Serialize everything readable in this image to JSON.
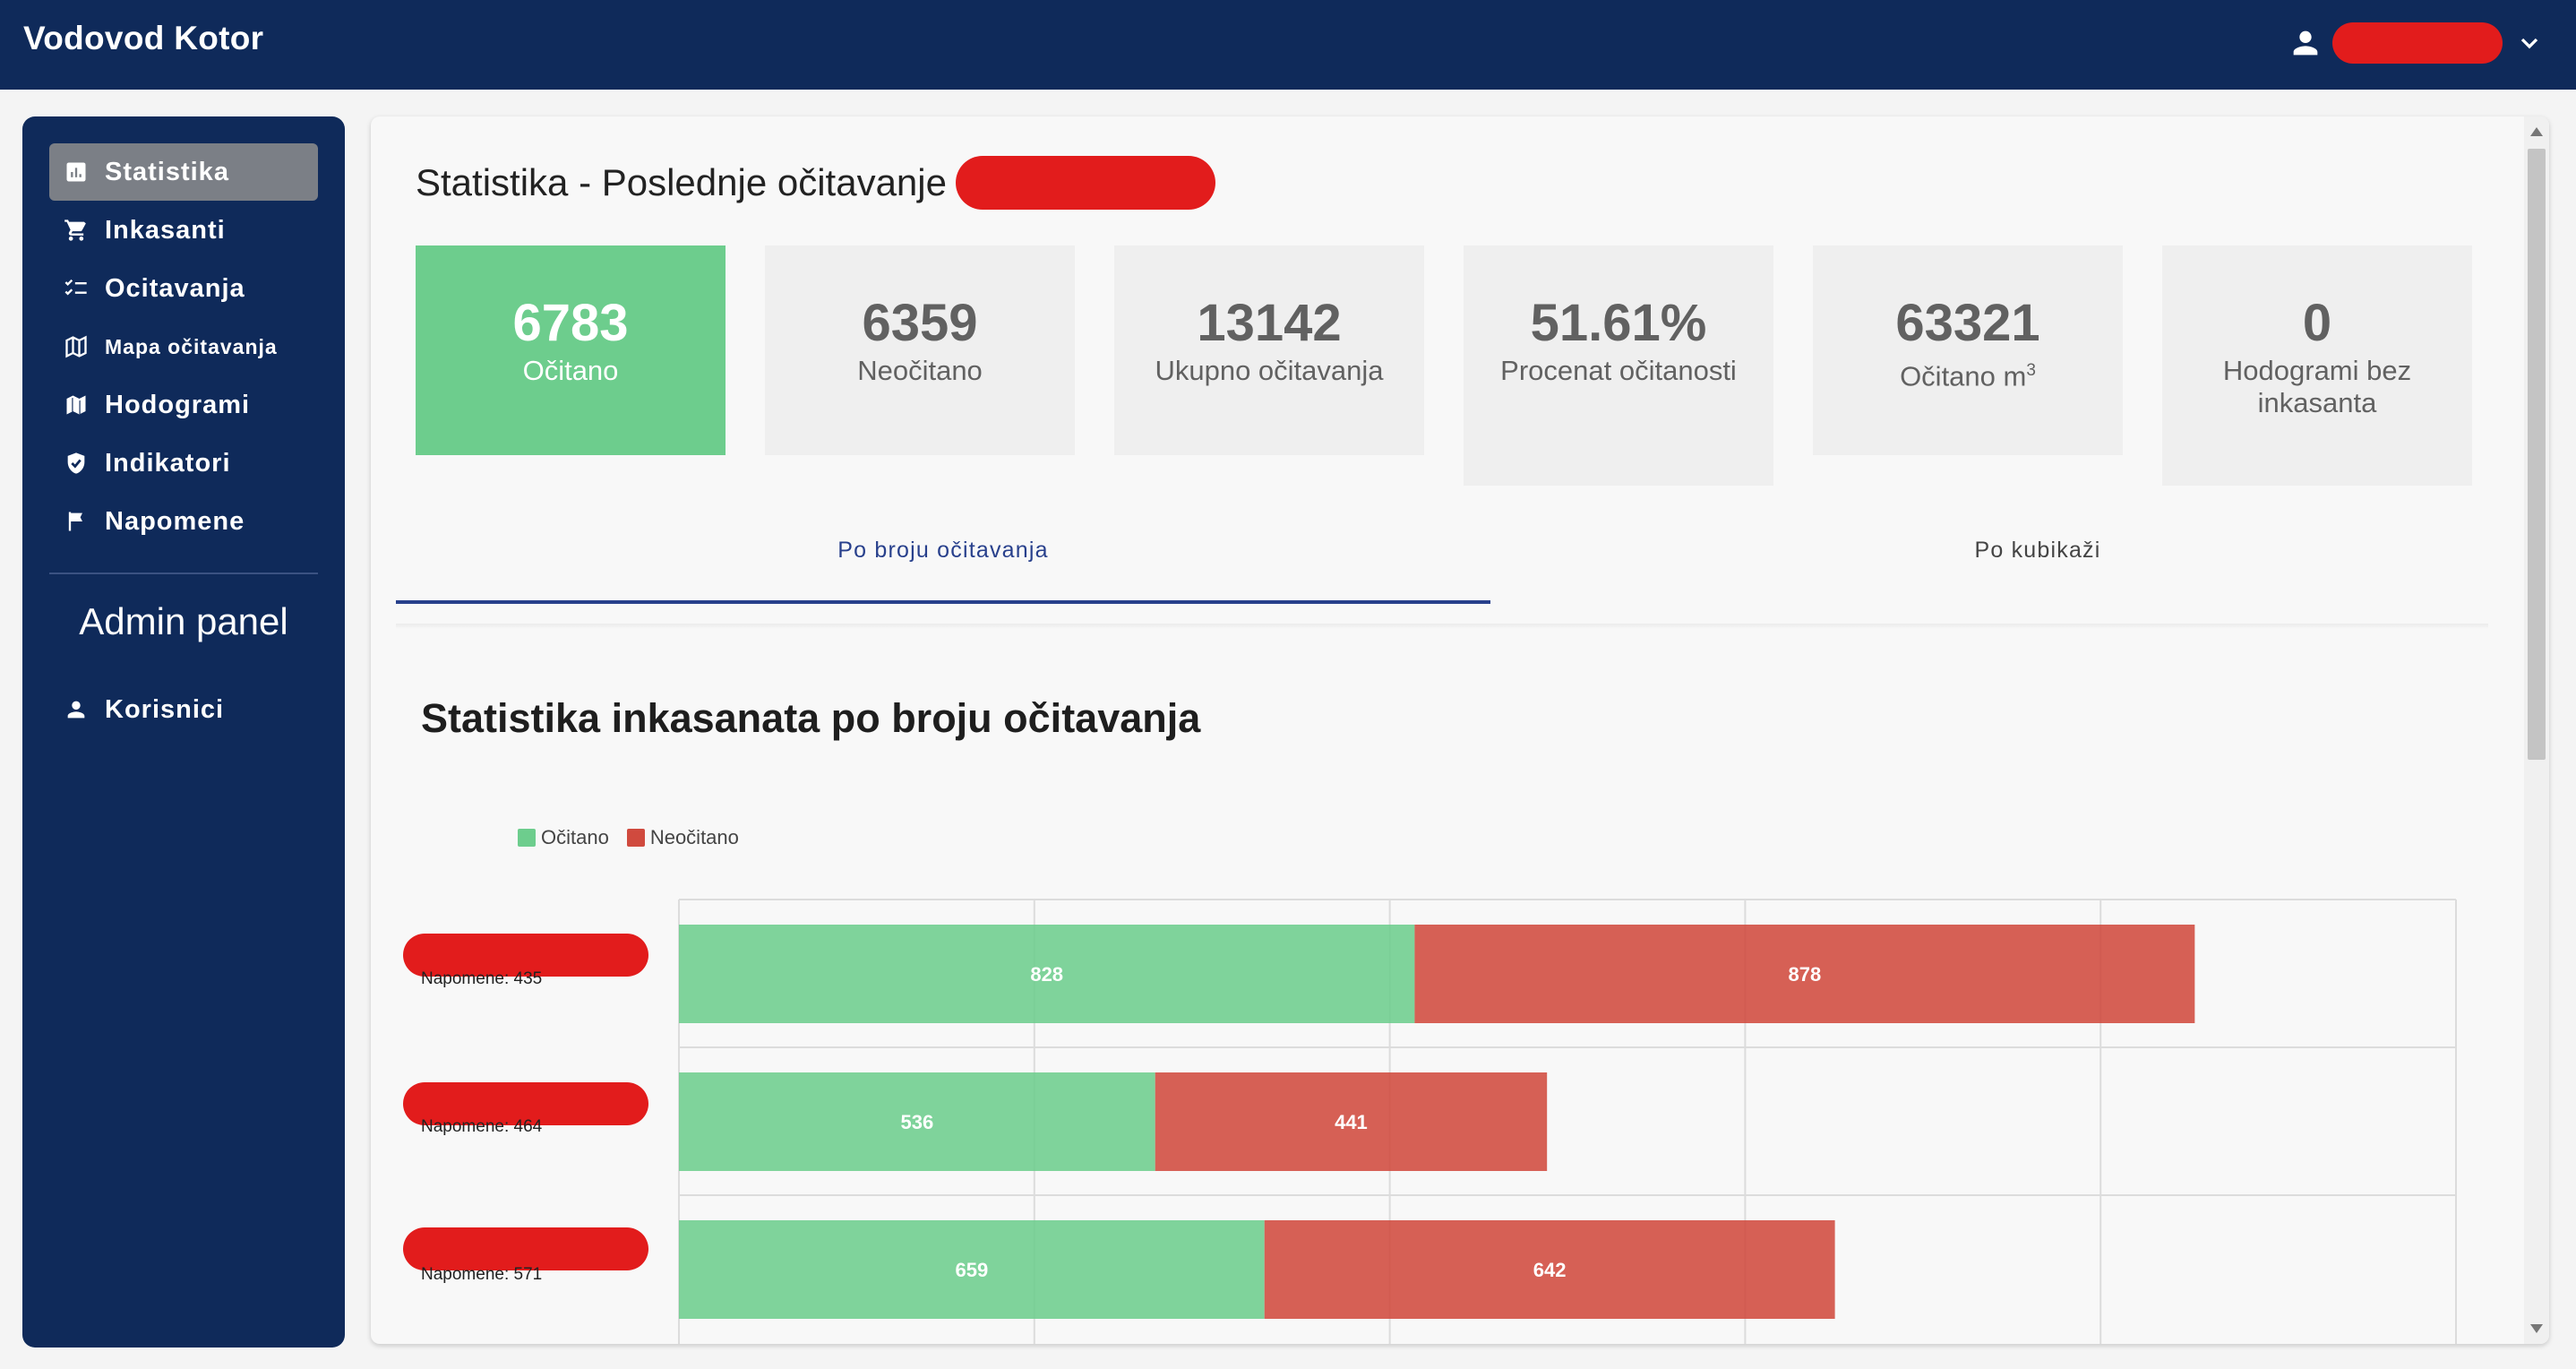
{
  "app": {
    "title": "Vodovod Kotor"
  },
  "header": {
    "user_icon": "person-icon",
    "menu_icon": "chevron-down-icon"
  },
  "sidebar": {
    "items": [
      {
        "label": "Statistika",
        "icon": "bar-chart-icon",
        "active": true
      },
      {
        "label": "Inkasanti",
        "icon": "cart-icon"
      },
      {
        "label": "Ocitavanja",
        "icon": "checklist-icon"
      },
      {
        "label": "Mapa očitavanja",
        "icon": "map-icon"
      },
      {
        "label": "Hodogrami",
        "icon": "map-filled-icon"
      },
      {
        "label": "Indikatori",
        "icon": "shield-check-icon"
      },
      {
        "label": "Napomene",
        "icon": "flag-icon"
      }
    ],
    "admin_title": "Admin panel",
    "admin_items": [
      {
        "label": "Korisnici",
        "icon": "person-icon"
      }
    ]
  },
  "main": {
    "title": "Statistika - Poslednje očitavanje",
    "kpis": [
      {
        "value": "6783",
        "label": "Očitano"
      },
      {
        "value": "6359",
        "label": "Neočitano"
      },
      {
        "value": "13142",
        "label": "Ukupno očitavanja"
      },
      {
        "value": "51.61%",
        "label": "Procenat očitanosti"
      },
      {
        "value": "63321",
        "label": "Očitano m",
        "sup": "3"
      },
      {
        "value": "0",
        "label": "Hodogrami bez inkasanta"
      }
    ],
    "tabs": [
      {
        "label": "Po broju očitavanja",
        "active": true
      },
      {
        "label": "Po kubikaži"
      }
    ],
    "chart_heading": "Statistika inkasanata po broju očitavanja"
  },
  "chart_data": {
    "type": "bar",
    "orientation": "horizontal",
    "stacked": true,
    "legend": [
      "Očitano",
      "Neočitano"
    ],
    "legend_position": "top-left",
    "grid": true,
    "categories": [
      "Napomene: 435",
      "Napomene: 464",
      "Napomene: 571"
    ],
    "series": [
      {
        "name": "Očitano",
        "color": "#6dcd8d",
        "values": [
          828,
          536,
          659
        ]
      },
      {
        "name": "Neočitano",
        "color": "#d04a3e",
        "values": [
          878,
          441,
          642
        ]
      }
    ],
    "xlim": [
      0,
      2000
    ]
  }
}
